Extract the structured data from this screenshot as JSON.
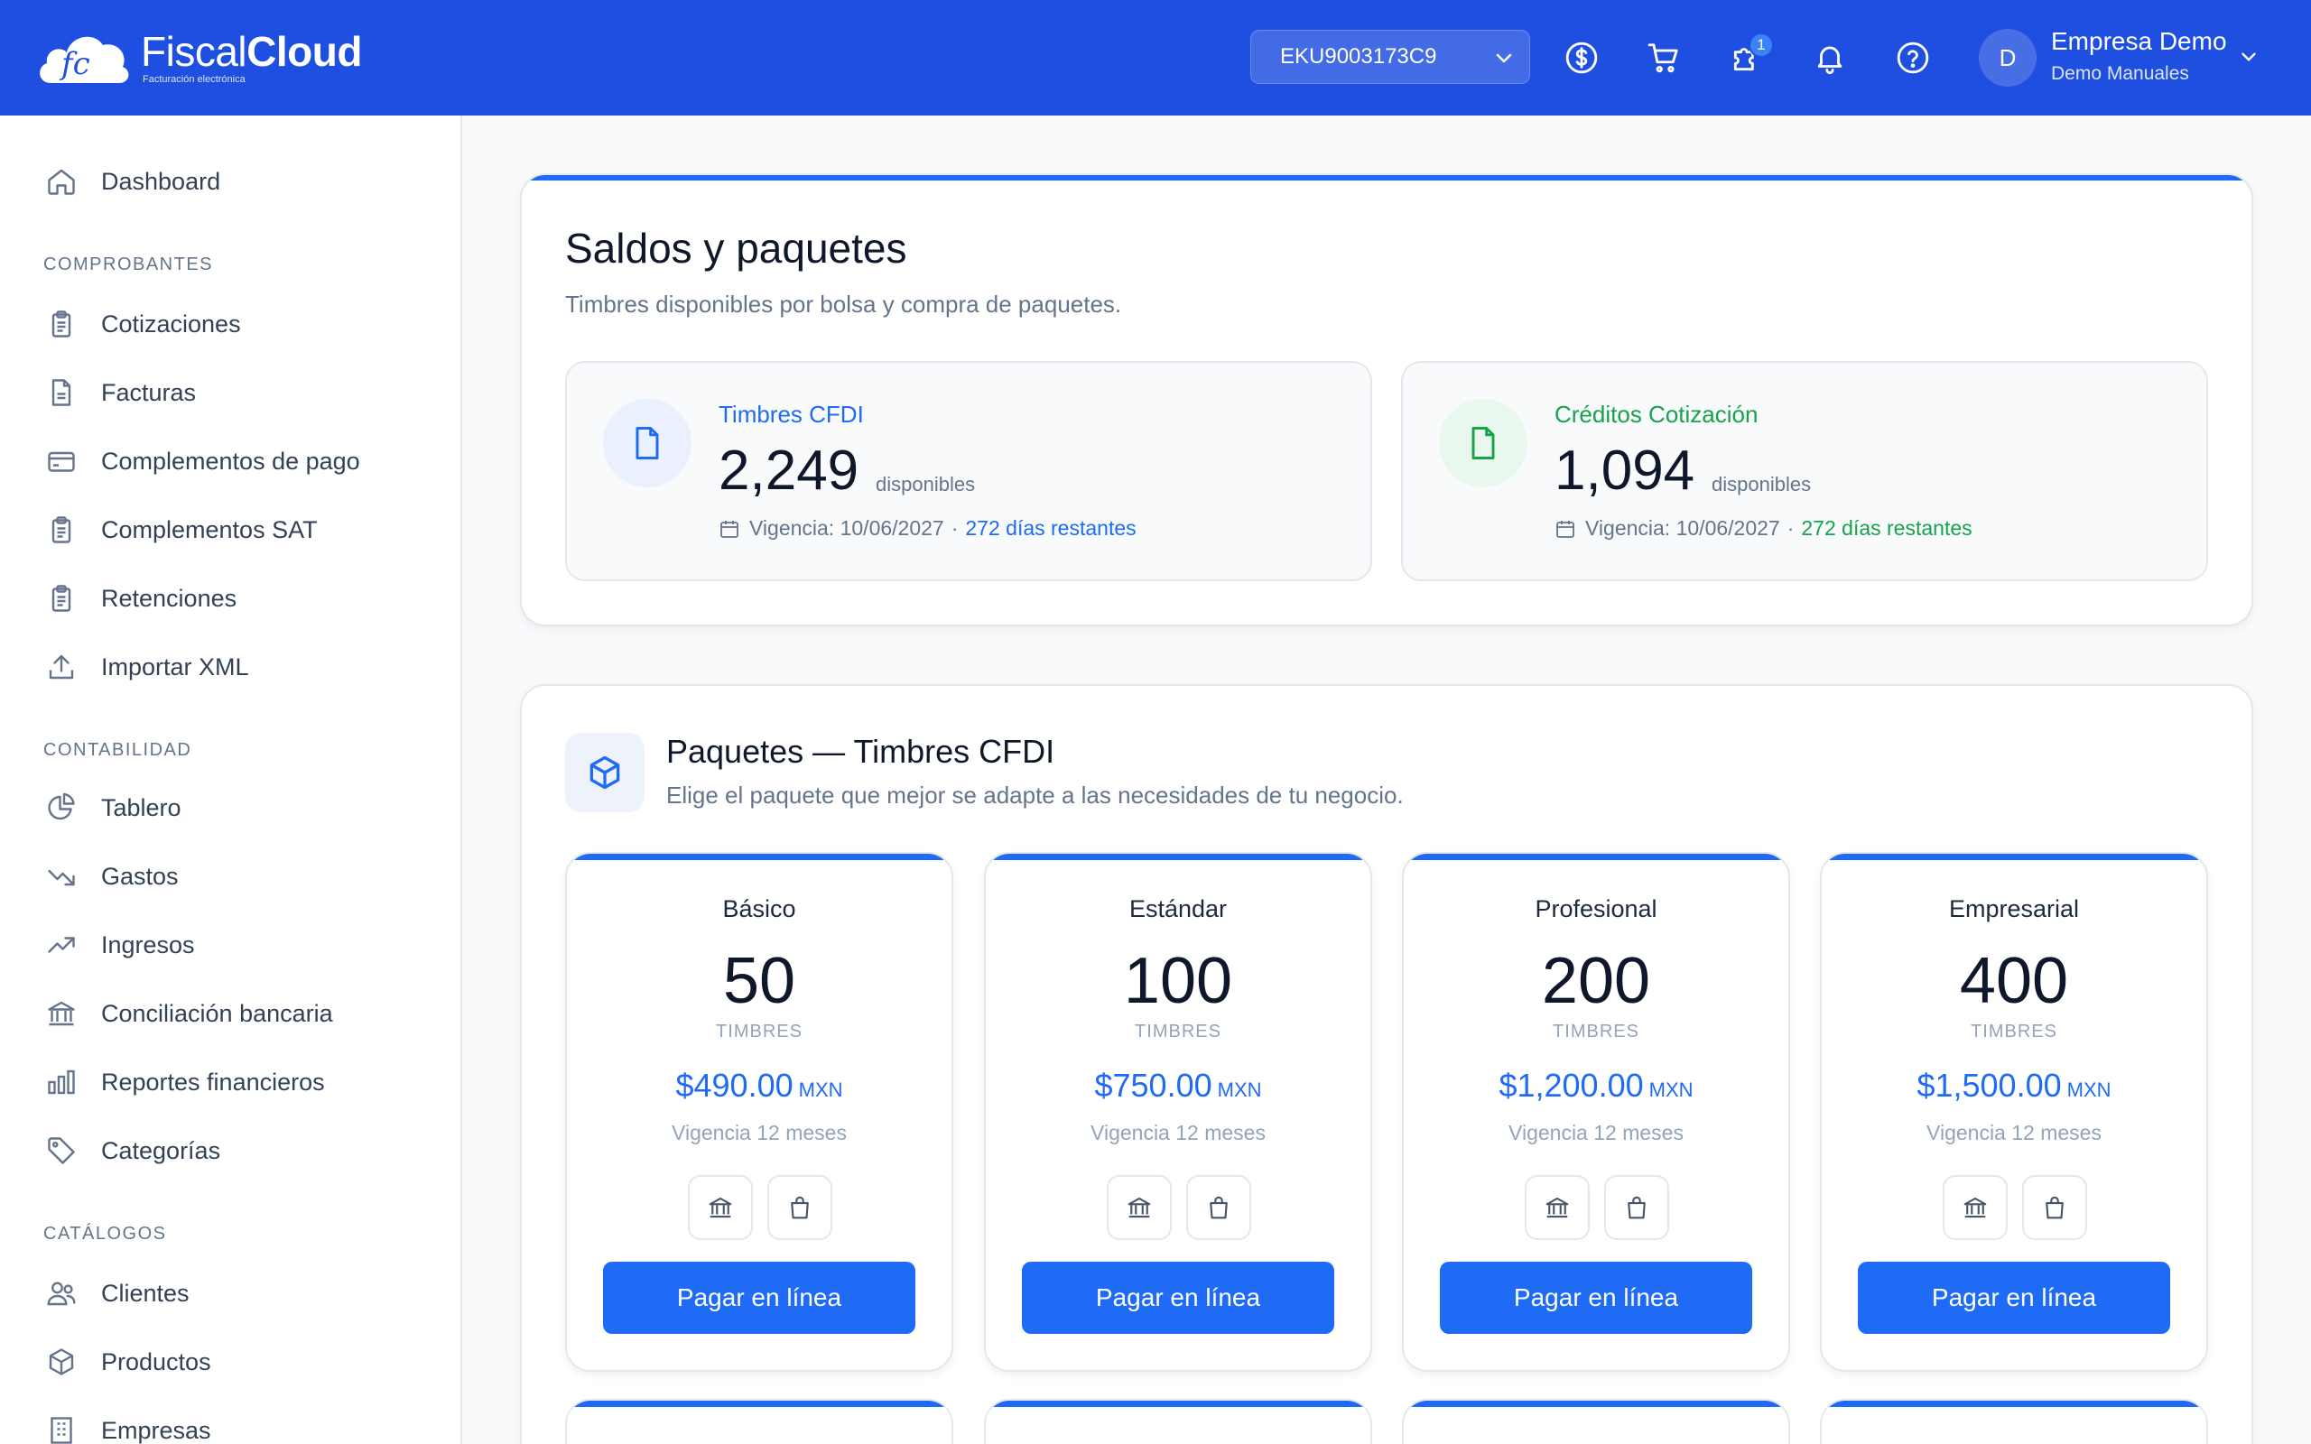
{
  "app": {
    "logo_light": "Fiscal",
    "logo_bold": "Cloud",
    "logo_tagline": "Facturación electrónica",
    "logo_mark": "fc"
  },
  "header": {
    "rfc_value": "EKU9003173C9",
    "icons": [
      "dollar-icon",
      "cart-icon",
      "puzzle-icon",
      "bell-icon",
      "help-icon"
    ],
    "notification_badge": "1",
    "avatar_initial": "D",
    "user_name": "Empresa Demo",
    "user_sub": "Demo Manuales"
  },
  "sidebar": {
    "dashboard": "Dashboard",
    "sec_comprobantes": "COMPROBANTES",
    "cotizaciones": "Cotizaciones",
    "facturas": "Facturas",
    "complementos_pago": "Complementos de pago",
    "complementos_sat": "Complementos SAT",
    "retenciones": "Retenciones",
    "importar_xml": "Importar XML",
    "sec_contabilidad": "CONTABILIDAD",
    "tablero": "Tablero",
    "gastos": "Gastos",
    "ingresos": "Ingresos",
    "conciliacion": "Conciliación bancaria",
    "reportes": "Reportes financieros",
    "categorias": "Categorías",
    "sec_catalogos": "CATÁLOGOS",
    "clientes": "Clientes",
    "productos": "Productos",
    "empresas": "Empresas"
  },
  "saldos": {
    "title": "Saldos y paquetes",
    "subtitle": "Timbres disponibles por bolsa y compra de paquetes.",
    "cfdi": {
      "label": "Timbres CFDI",
      "count": "2,249",
      "unit": "disponibles",
      "vigencia": "Vigencia: 10/06/2027",
      "dot": "·",
      "restantes": "272 días restantes",
      "color": "#1f6bf5"
    },
    "cotizacion": {
      "label": "Créditos Cotización",
      "count": "1,094",
      "unit": "disponibles",
      "vigencia": "Vigencia: 10/06/2027",
      "dot": "·",
      "restantes": "272 días restantes",
      "color": "#16a34a"
    }
  },
  "paquetes": {
    "title": "Paquetes — Timbres CFDI",
    "subtitle": "Elige el paquete que mejor se adapte a las necesidades de tu negocio.",
    "items": [
      {
        "name": "Básico",
        "qty": "50",
        "unit": "TIMBRES",
        "price": "$490.00",
        "currency": "MXN",
        "vigencia": "Vigencia 12 meses",
        "button": "Pagar en línea"
      },
      {
        "name": "Estándar",
        "qty": "100",
        "unit": "TIMBRES",
        "price": "$750.00",
        "currency": "MXN",
        "vigencia": "Vigencia 12 meses",
        "button": "Pagar en línea"
      },
      {
        "name": "Profesional",
        "qty": "200",
        "unit": "TIMBRES",
        "price": "$1,200.00",
        "currency": "MXN",
        "vigencia": "Vigencia 12 meses",
        "button": "Pagar en línea"
      },
      {
        "name": "Empresarial",
        "qty": "400",
        "unit": "TIMBRES",
        "price": "$1,500.00",
        "currency": "MXN",
        "vigencia": "Vigencia 12 meses",
        "button": "Pagar en línea"
      }
    ]
  },
  "colors": {
    "header_bg": "#1f4fe0",
    "accent": "#1f6bf5",
    "success": "#16a34a"
  }
}
